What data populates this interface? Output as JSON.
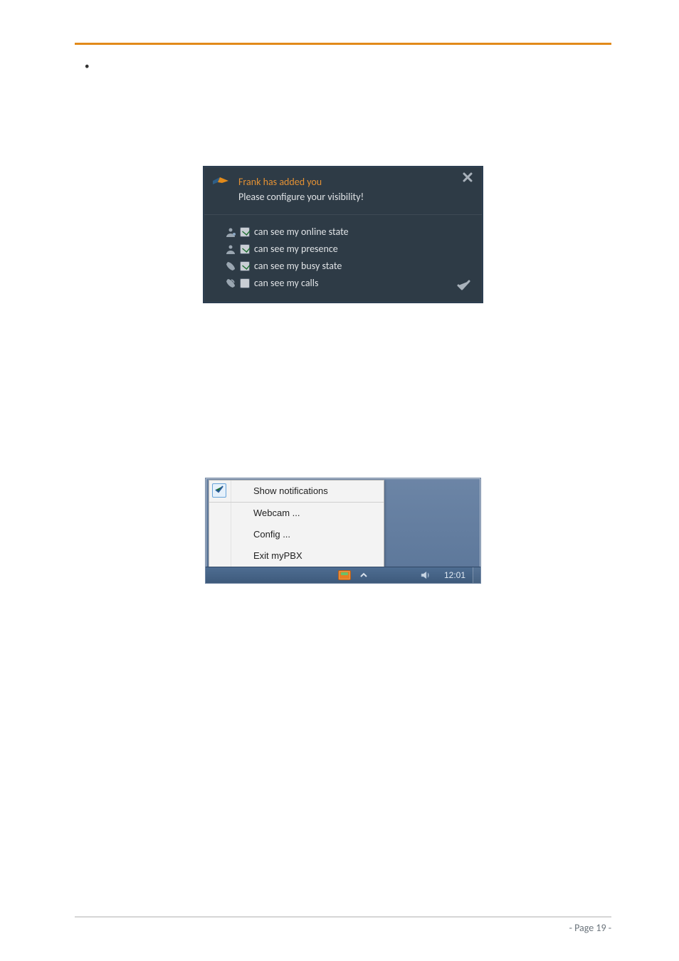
{
  "bullets": [
    " ",
    " "
  ],
  "toast": {
    "title": "Frank has added you",
    "subtitle": "Please configure your visibility!",
    "options": [
      {
        "label": "can see my online state",
        "checked": true
      },
      {
        "label": "can see my presence",
        "checked": true
      },
      {
        "label": "can see my busy state",
        "checked": true
      },
      {
        "label": "can see my calls",
        "checked": false
      }
    ]
  },
  "tray_menu": {
    "items": [
      {
        "label": "Show notifications",
        "checked": true,
        "separator": false
      },
      {
        "label": "Webcam ...",
        "checked": false,
        "separator": true
      },
      {
        "label": "Config ...",
        "checked": false,
        "separator": false
      },
      {
        "label": "Exit myPBX",
        "checked": false,
        "separator": false
      }
    ],
    "clock": "12:01"
  },
  "footer": {
    "left": " ",
    "page": "- Page 19 -"
  }
}
